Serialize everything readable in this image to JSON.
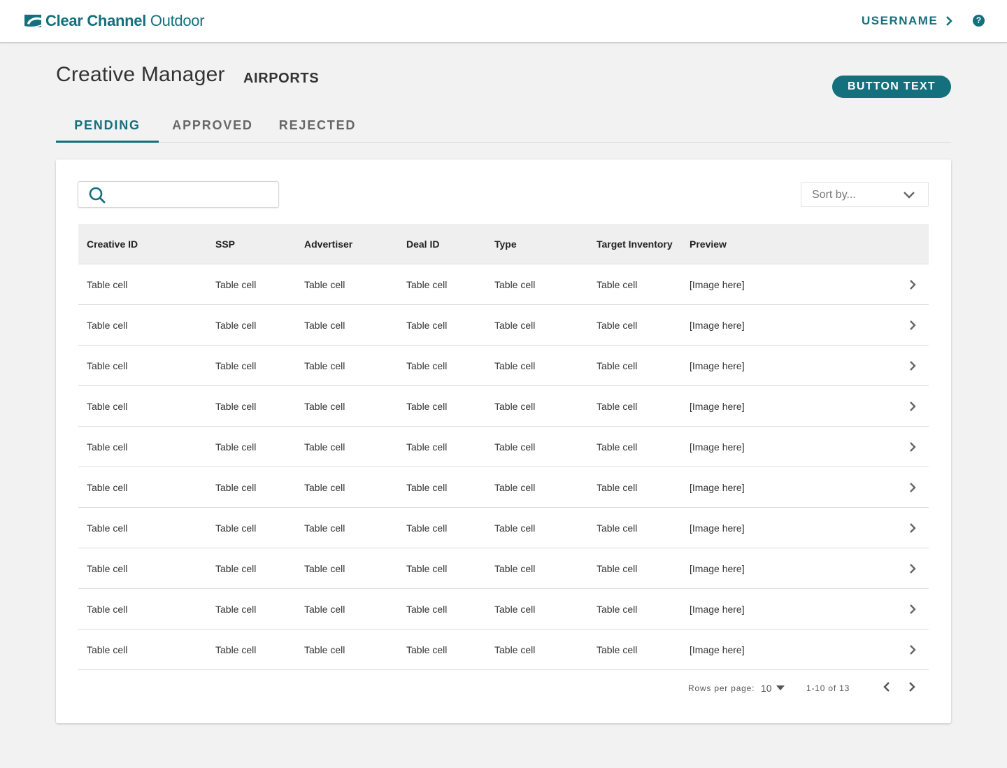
{
  "header": {
    "logo_part1": "Clear Channel",
    "logo_part2": "Outdoor",
    "username": "USERNAME",
    "help_glyph": "?",
    "brand_color": "#13707c"
  },
  "page": {
    "title": "Creative Manager",
    "subtitle": "AIRPORTS",
    "primary_button": "BUTTON TEXT"
  },
  "tabs": [
    {
      "label": "PENDING",
      "active": true
    },
    {
      "label": "APPROVED",
      "active": false
    },
    {
      "label": "REJECTED",
      "active": false
    }
  ],
  "search": {
    "placeholder": "",
    "value": ""
  },
  "sort": {
    "label": "Sort by..."
  },
  "table": {
    "columns": [
      "Creative ID",
      "SSP",
      "Advertiser",
      "Deal ID",
      "Type",
      "Target Inventory",
      "Preview"
    ],
    "rows": [
      [
        "Table cell",
        "Table cell",
        "Table cell",
        "Table cell",
        "Table cell",
        "Table cell",
        "[Image here]"
      ],
      [
        "Table cell",
        "Table cell",
        "Table cell",
        "Table cell",
        "Table cell",
        "Table cell",
        "[Image here]"
      ],
      [
        "Table cell",
        "Table cell",
        "Table cell",
        "Table cell",
        "Table cell",
        "Table cell",
        "[Image here]"
      ],
      [
        "Table cell",
        "Table cell",
        "Table cell",
        "Table cell",
        "Table cell",
        "Table cell",
        "[Image here]"
      ],
      [
        "Table cell",
        "Table cell",
        "Table cell",
        "Table cell",
        "Table cell",
        "Table cell",
        "[Image here]"
      ],
      [
        "Table cell",
        "Table cell",
        "Table cell",
        "Table cell",
        "Table cell",
        "Table cell",
        "[Image here]"
      ],
      [
        "Table cell",
        "Table cell",
        "Table cell",
        "Table cell",
        "Table cell",
        "Table cell",
        "[Image here]"
      ],
      [
        "Table cell",
        "Table cell",
        "Table cell",
        "Table cell",
        "Table cell",
        "Table cell",
        "[Image here]"
      ],
      [
        "Table cell",
        "Table cell",
        "Table cell",
        "Table cell",
        "Table cell",
        "Table cell",
        "[Image here]"
      ],
      [
        "Table cell",
        "Table cell",
        "Table cell",
        "Table cell",
        "Table cell",
        "Table cell",
        "[Image here]"
      ]
    ]
  },
  "pagination": {
    "rows_per_page_label": "Rows per page:",
    "rows_per_page": "10",
    "range": "1-10 of 13"
  },
  "icons": {
    "logo": "clear-channel-logo-icon",
    "user_menu": "chevron-right-icon",
    "help": "help-circle-icon",
    "search": "search-icon",
    "sort": "chevron-down-icon",
    "row": "chevron-right-icon",
    "rows_per_page": "caret-down-icon",
    "prev": "chevron-left-icon",
    "next": "chevron-right-icon"
  }
}
